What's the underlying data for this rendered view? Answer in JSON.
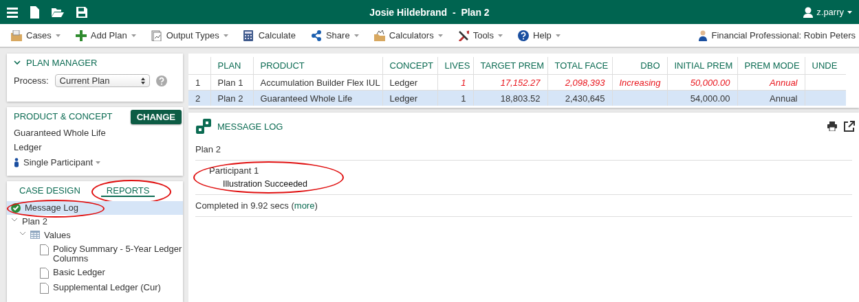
{
  "top_bar": {
    "title": "Josie Hildebrand  -  Plan 2",
    "user": "z.parry"
  },
  "toolbar": {
    "items": [
      {
        "label": "Cases",
        "kind": "cases",
        "dropdown": true
      },
      {
        "label": "Add Plan",
        "kind": "add",
        "dropdown": true
      },
      {
        "label": "Output Types",
        "kind": "output",
        "dropdown": true
      },
      {
        "label": "Calculate",
        "kind": "calculate",
        "dropdown": false
      },
      {
        "label": "Share",
        "kind": "share",
        "dropdown": true
      },
      {
        "label": "Calculators",
        "kind": "calculators",
        "dropdown": true
      },
      {
        "label": "Tools",
        "kind": "tools",
        "dropdown": true
      },
      {
        "label": "Help",
        "kind": "help",
        "dropdown": true
      }
    ],
    "professional": "Financial Professional: Robin Peters"
  },
  "plan_manager": {
    "title": "PLAN MANAGER",
    "expanded": true,
    "process_label": "Process:",
    "process_value": "Current Plan"
  },
  "product_concept": {
    "title": "PRODUCT & CONCEPT",
    "button": "CHANGE",
    "product": "Guaranteed Whole Life",
    "concept": "Ledger",
    "participants": "Single Participant"
  },
  "side_tabs": [
    {
      "label": "CASE DESIGN",
      "selected": false,
      "highlighted": false
    },
    {
      "label": "REPORTS",
      "selected": true,
      "highlighted": true
    }
  ],
  "report_tree": [
    {
      "label": "Message Log",
      "kind": "status",
      "selected": true,
      "highlighted": true
    },
    {
      "label": "Plan 2",
      "kind": "group",
      "selected": false,
      "highlighted": false,
      "expanded": true,
      "children": [
        {
          "label": "Values",
          "kind": "grid",
          "selected": false,
          "highlighted": false,
          "expanded": true,
          "children": [
            {
              "label": "Policy Summary - 5-Year Ledger Columns",
              "kind": "document",
              "selected": false,
              "highlighted": false
            },
            {
              "label": "Basic Ledger",
              "kind": "document",
              "selected": false,
              "highlighted": false
            },
            {
              "label": "Supplemental Ledger (Cur)",
              "kind": "document",
              "selected": false,
              "highlighted": false
            }
          ]
        }
      ]
    }
  ],
  "plan_table": {
    "columns": [
      "PLAN",
      "PRODUCT",
      "CONCEPT",
      "LIVES",
      "TARGET PREM",
      "TOTAL FACE",
      "DBO",
      "INITIAL PREM",
      "PREM MODE",
      "UNDE"
    ],
    "rows": [
      {
        "number": "1",
        "selected": false,
        "cells": [
          {
            "text": "Plan 1",
            "changed": false
          },
          {
            "text": "Accumulation Builder Flex IUL",
            "changed": false
          },
          {
            "text": "Ledger",
            "changed": false
          },
          {
            "text": "1",
            "changed": true
          },
          {
            "text": "17,152.27",
            "changed": true
          },
          {
            "text": "2,098,393",
            "changed": true
          },
          {
            "text": "Increasing",
            "changed": true
          },
          {
            "text": "50,000.00",
            "changed": true
          },
          {
            "text": "Annual",
            "changed": true
          }
        ]
      },
      {
        "number": "2",
        "selected": true,
        "cells": [
          {
            "text": "Plan 2",
            "changed": false
          },
          {
            "text": "Guaranteed Whole Life",
            "changed": false
          },
          {
            "text": "Ledger",
            "changed": false
          },
          {
            "text": "1",
            "changed": false
          },
          {
            "text": "18,803.52",
            "changed": false
          },
          {
            "text": "2,430,645",
            "changed": false
          },
          null,
          {
            "text": "54,000.00",
            "changed": false
          },
          {
            "text": "Annual",
            "changed": false
          }
        ]
      }
    ]
  },
  "message_log": {
    "title": "MESSAGE LOG",
    "plan": "Plan 2",
    "participants": [
      {
        "name": "Participant 1",
        "message": "Illustration Succeeded",
        "highlighted": true
      }
    ],
    "completed": "Completed in 9.92 secs (",
    "more_link": "more",
    "completed_end": ")"
  }
}
